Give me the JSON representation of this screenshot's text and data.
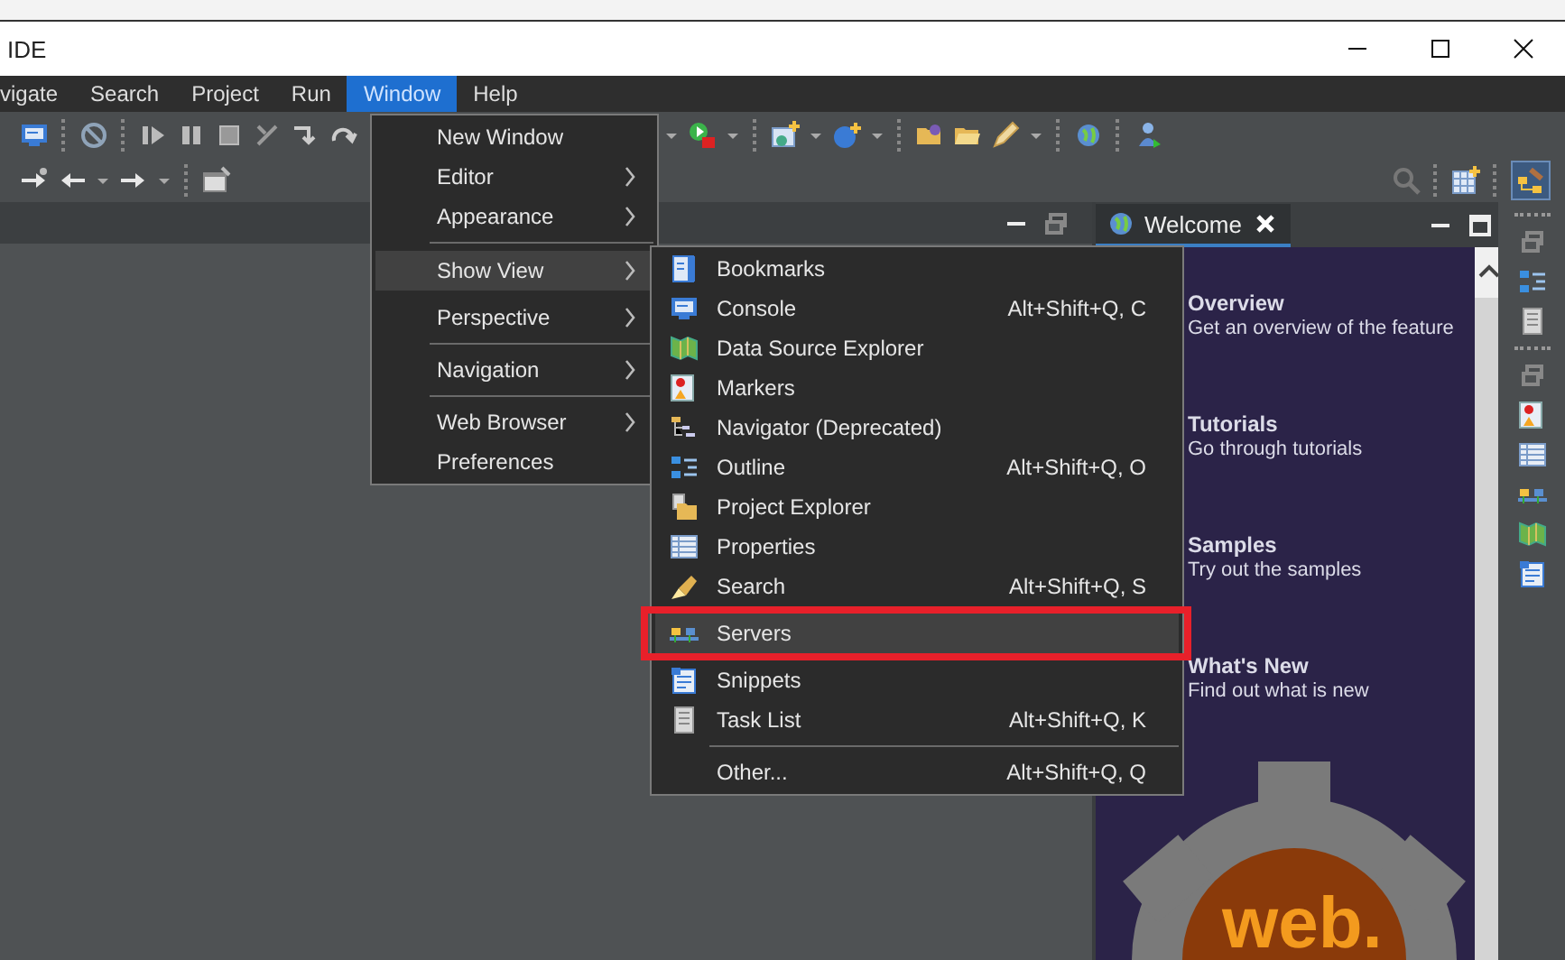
{
  "window": {
    "title": "IDE"
  },
  "menubar": [
    {
      "label": "vigate",
      "selected": false
    },
    {
      "label": "Search",
      "selected": false
    },
    {
      "label": "Project",
      "selected": false
    },
    {
      "label": "Run",
      "selected": false
    },
    {
      "label": "Window",
      "selected": true
    },
    {
      "label": "Help",
      "selected": false
    }
  ],
  "window_menu": {
    "groups": [
      {
        "items": [
          {
            "label": "New Window",
            "submenu": false,
            "selected": false
          },
          {
            "label": "Editor",
            "submenu": true,
            "selected": false
          },
          {
            "label": "Appearance",
            "submenu": true,
            "selected": false
          }
        ]
      },
      {
        "items": [
          {
            "label": "Show View",
            "submenu": true,
            "selected": true
          },
          {
            "label": "Perspective",
            "submenu": true,
            "selected": false
          }
        ]
      },
      {
        "items": [
          {
            "label": "Navigation",
            "submenu": true,
            "selected": false
          }
        ]
      },
      {
        "items": [
          {
            "label": "Web Browser",
            "submenu": true,
            "selected": false
          },
          {
            "label": "Preferences",
            "submenu": false,
            "selected": false
          }
        ]
      }
    ]
  },
  "show_view_menu": {
    "groups": [
      {
        "items": [
          {
            "label": "Bookmarks",
            "selected": false
          },
          {
            "label": "Console",
            "shortcut": "Alt+Shift+Q, C",
            "selected": false
          },
          {
            "label": "Data Source Explorer",
            "selected": false
          },
          {
            "label": "Markers",
            "selected": false
          },
          {
            "label": "Navigator (Deprecated)",
            "selected": false
          },
          {
            "label": "Outline",
            "shortcut": "Alt+Shift+Q, O",
            "selected": false
          },
          {
            "label": "Project Explorer",
            "selected": false
          },
          {
            "label": "Properties",
            "selected": false
          },
          {
            "label": "Search",
            "shortcut": "Alt+Shift+Q, S",
            "selected": false
          },
          {
            "label": "Servers",
            "selected": true
          },
          {
            "label": "Snippets",
            "selected": false
          },
          {
            "label": "Task List",
            "shortcut": "Alt+Shift+Q, K",
            "selected": false
          }
        ]
      },
      {
        "items": [
          {
            "label": "Other...",
            "shortcut": "Alt+Shift+Q, Q",
            "selected": false
          }
        ]
      }
    ]
  },
  "editor": {
    "tabs": [
      {
        "label": "Welcome",
        "selected": true
      }
    ],
    "sections": [
      {
        "title": "Overview",
        "description": "Get an overview of the feature"
      },
      {
        "title": "Tutorials",
        "description": "Go through tutorials"
      },
      {
        "title": "Samples",
        "description": "Try out the samples"
      },
      {
        "title": "What's New",
        "description": "Find out what is new"
      }
    ],
    "logo_text": "web."
  }
}
